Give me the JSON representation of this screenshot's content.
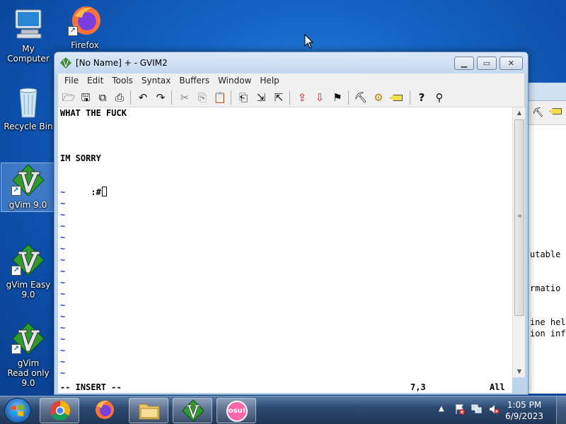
{
  "desktop": {
    "icons": [
      {
        "label": "My Computer"
      },
      {
        "label": "Firefox"
      },
      {
        "label": "Recycle Bin"
      },
      {
        "label": "gVim 9.0"
      },
      {
        "label": "gVim Easy 9.0"
      },
      {
        "label": "gVim Read only 9.0"
      }
    ]
  },
  "background_window": {
    "text_lines": [
      "utable",
      "rmatio",
      "ine hel",
      "ion inf"
    ]
  },
  "window": {
    "title": "[No Name] + - GVIM2",
    "menu": [
      "File",
      "Edit",
      "Tools",
      "Syntax",
      "Buffers",
      "Window",
      "Help"
    ],
    "toolbar_icons": [
      "open-icon",
      "save-icon",
      "save-all-icon",
      "print-icon",
      "undo-icon",
      "redo-icon",
      "cut-icon",
      "copy-icon",
      "paste-icon",
      "find-replace-icon",
      "find-next-icon",
      "find-prev-icon",
      "load-session-icon",
      "save-session-icon",
      "run-script-icon",
      "make-icon",
      "build-tags-icon",
      "jump-tag-icon",
      "help-icon",
      "find-help-icon"
    ],
    "buffer_lines": [
      "WHAT THE FUCK",
      "",
      "",
      "",
      "IM SORRY",
      "",
      ":#"
    ],
    "tilde": "~",
    "status": {
      "mode": "-- INSERT --",
      "position": "7,3",
      "scroll": "All"
    }
  },
  "taskbar": {
    "osu_label": "osu!",
    "clock_time": "1:05 PM",
    "clock_date": "6/9/2023"
  }
}
